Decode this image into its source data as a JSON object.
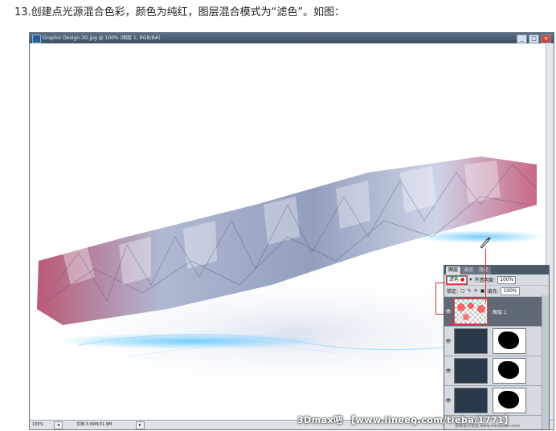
{
  "instruction": "13.创建点光源混合色彩，颜色为纯红，图层混合模式为“滤色”。如图：",
  "window": {
    "title": "Graphic Design-3D.jpg @ 100% (图层 1, RGB/8#)",
    "buttons": [
      "_",
      "□",
      "×"
    ]
  },
  "status": {
    "zoom": "100%",
    "doc_size": "文档:3.09M/31.9M"
  },
  "layers_panel": {
    "tabs": [
      "图层",
      "通道",
      "路径"
    ],
    "active_tab": "图层",
    "blend_mode": "滤色",
    "opacity_label": "不透明度:",
    "opacity_value": "100%",
    "lock_label": "锁定:",
    "fill_label": "填充:",
    "fill_value": "100%",
    "layers": [
      {
        "name": "图层 1",
        "active": true
      },
      {
        "name": "",
        "active": false
      },
      {
        "name": "",
        "active": false
      },
      {
        "name": "",
        "active": false
      }
    ]
  },
  "watermark": {
    "text": "3Dmax吧 【www.lineeg.com/tieba/1771】",
    "small": "思缘设计论坛 www.missyuan.com"
  },
  "colors": {
    "accent_red": "#ff0000",
    "panel_bg": "#d6dbe1"
  }
}
